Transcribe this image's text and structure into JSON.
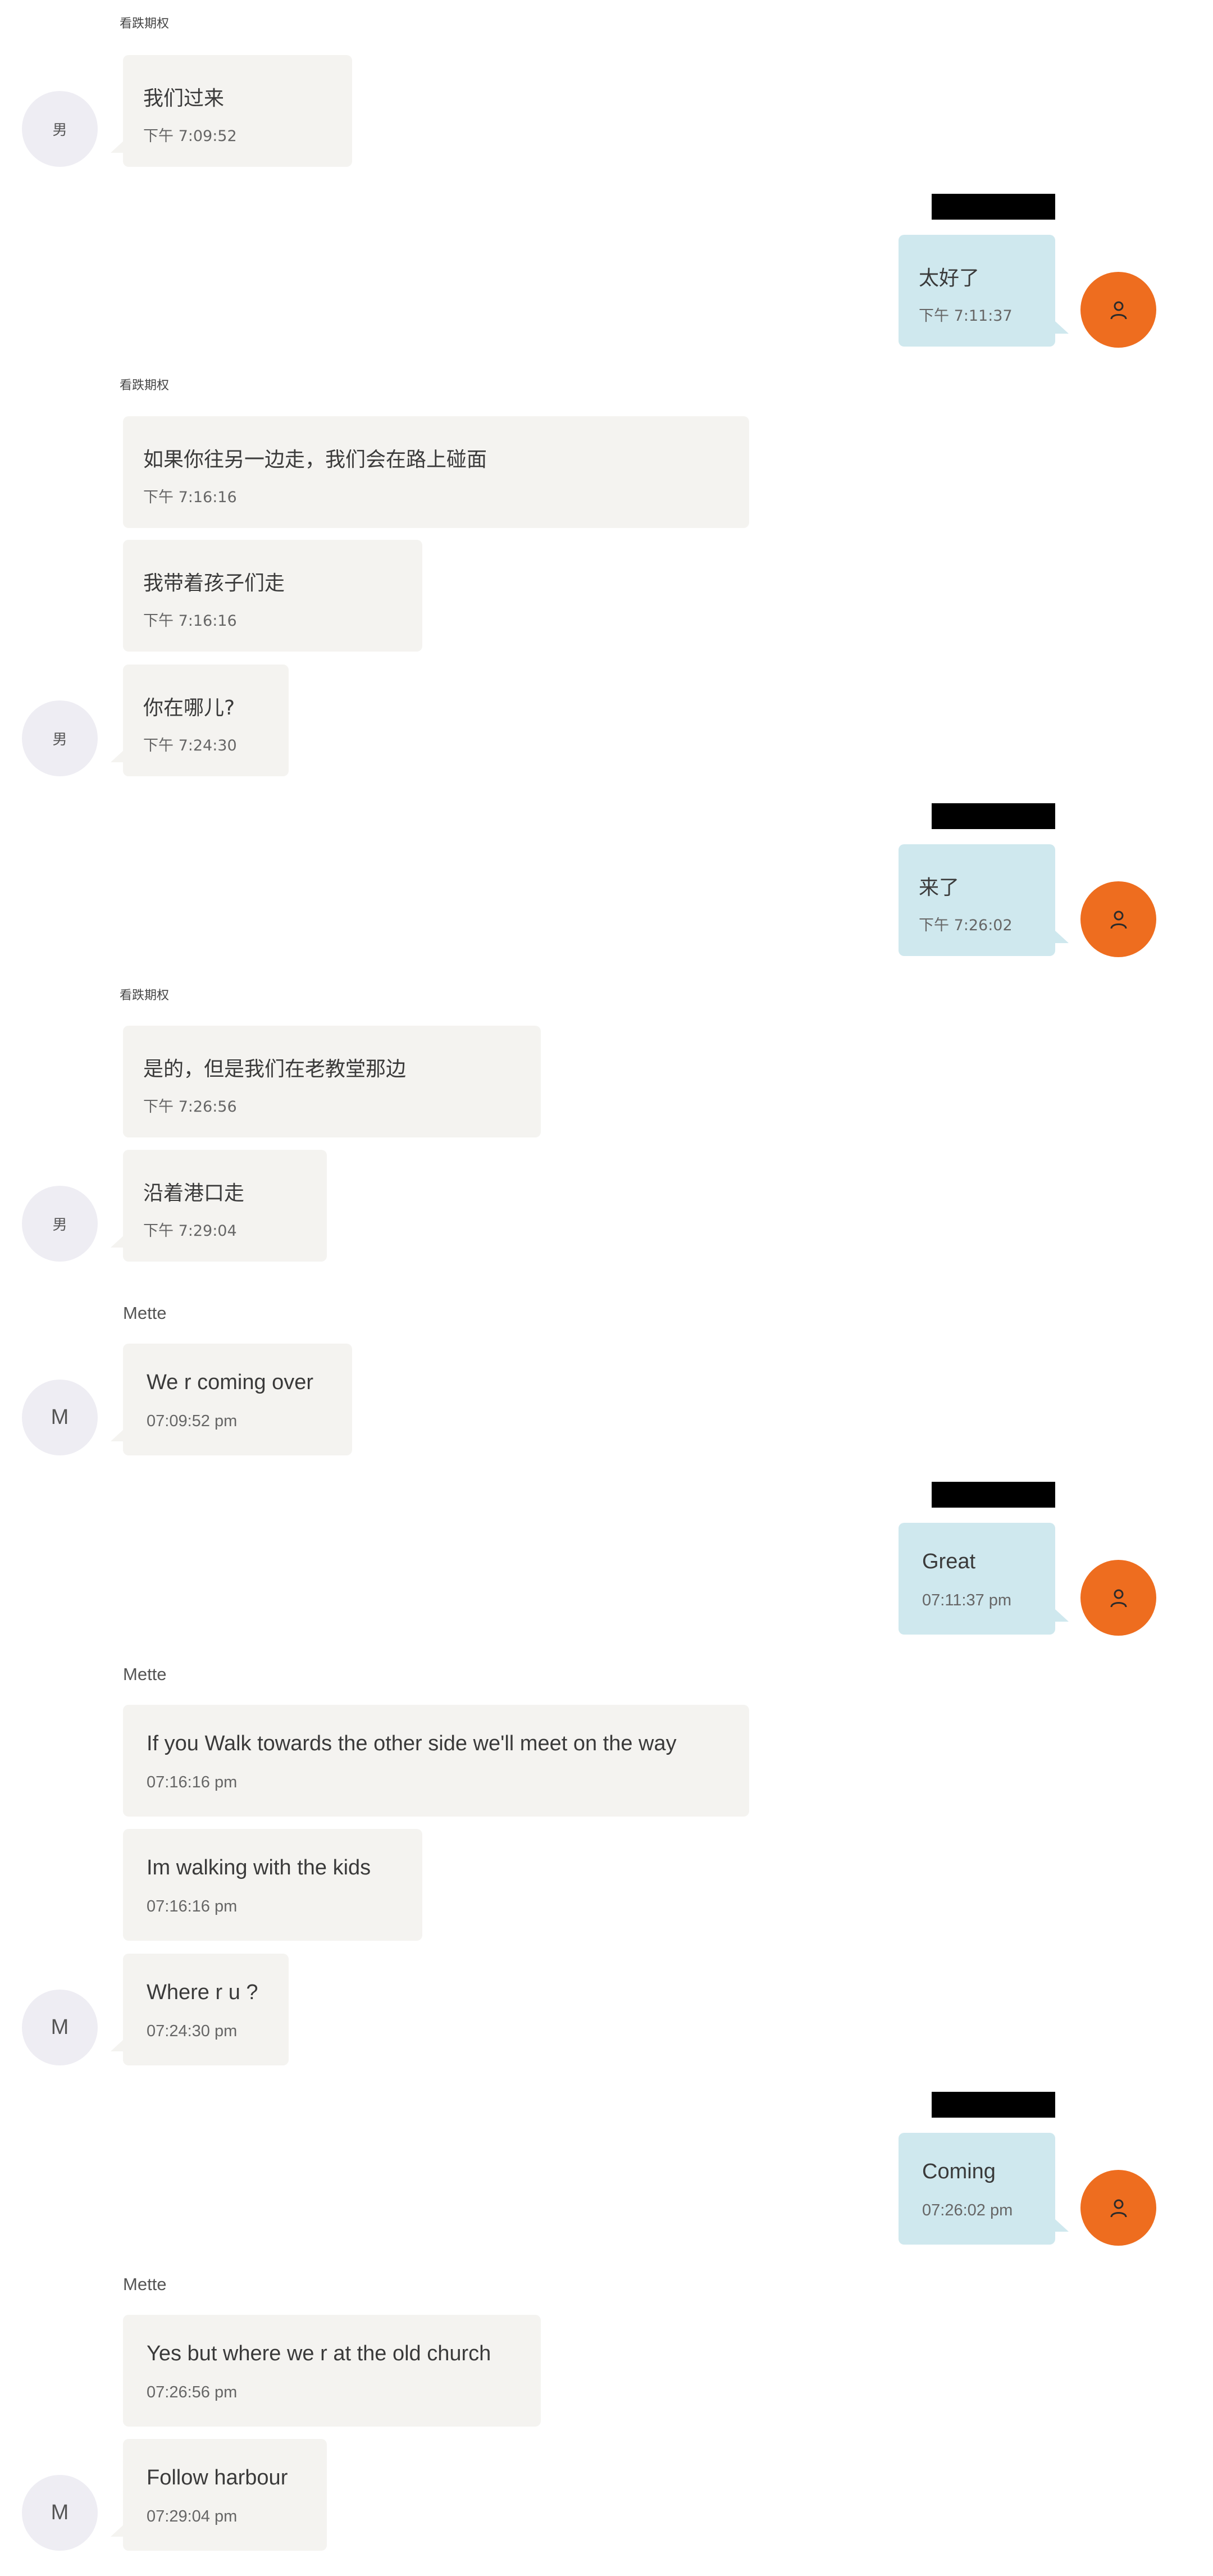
{
  "colors": {
    "incoming_bubble": "#f4f3f0",
    "outgoing_bubble": "#cfe8ee",
    "self_avatar": "#ee6d1f",
    "contact_avatar": "#eeedf3",
    "redaction": "#000000"
  },
  "zh": {
    "contact_name": "看跌期权",
    "contact_avatar": "男",
    "messages": [
      {
        "text": "我们过来",
        "time": "下午 7:09:52"
      },
      {
        "text": "太好了",
        "time": "下午 7:11:37"
      },
      {
        "text": "如果你往另一边走，我们会在路上碰面",
        "time": "下午 7:16:16"
      },
      {
        "text": "我带着孩子们走",
        "time": "下午 7:16:16"
      },
      {
        "text": "你在哪儿?",
        "time": "下午 7:24:30"
      },
      {
        "text": "来了",
        "time": "下午 7:26:02"
      },
      {
        "text": "是的，但是我们在老教堂那边",
        "time": "下午 7:26:56"
      },
      {
        "text": "沿着港口走",
        "time": "下午 7:29:04"
      }
    ]
  },
  "en": {
    "contact_name": "Mette",
    "contact_avatar": "M",
    "messages": [
      {
        "text": "We r coming over",
        "time": "07:09:52 pm"
      },
      {
        "text": "Great",
        "time": "07:11:37 pm"
      },
      {
        "text": "If you Walk towards the other side we'll meet on the way",
        "time": "07:16:16 pm"
      },
      {
        "text": "Im walking with the kids",
        "time": "07:16:16 pm"
      },
      {
        "text": "Where r u ?",
        "time": "07:24:30 pm"
      },
      {
        "text": "Coming",
        "time": "07:26:02 pm"
      },
      {
        "text": "Yes but where we r at the old church",
        "time": "07:26:56 pm"
      },
      {
        "text": "Follow harbour",
        "time": "07:29:04 pm"
      }
    ]
  }
}
